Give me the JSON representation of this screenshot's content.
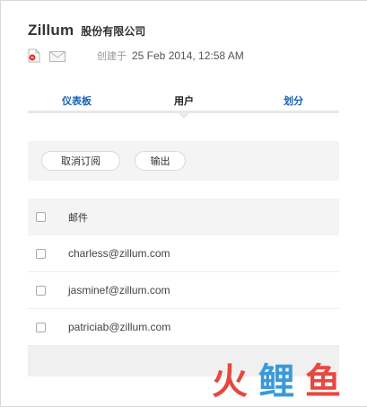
{
  "header": {
    "brand": "Zillum",
    "company": "股份有限公司",
    "created_label": "创建于",
    "created_value": "25 Feb 2014, 12:58 AM",
    "icons": [
      "pdf-icon",
      "mail-icon"
    ]
  },
  "tabs": [
    {
      "label": "仪表板",
      "active": false
    },
    {
      "label": "用户",
      "active": true
    },
    {
      "label": "划分",
      "active": false
    }
  ],
  "toolbar": {
    "unsubscribe_label": "取消订阅",
    "export_label": "输出"
  },
  "table": {
    "header_label": "邮件",
    "rows": [
      {
        "email": "charless@zillum.com"
      },
      {
        "email": "jasminef@zillum.com"
      },
      {
        "email": "patriciab@zillum.com"
      }
    ]
  },
  "watermark": {
    "chars": [
      "火",
      "鲤",
      "鱼"
    ],
    "colors": [
      "#e8473f",
      "#3a9ad9",
      "#e8473f"
    ]
  }
}
